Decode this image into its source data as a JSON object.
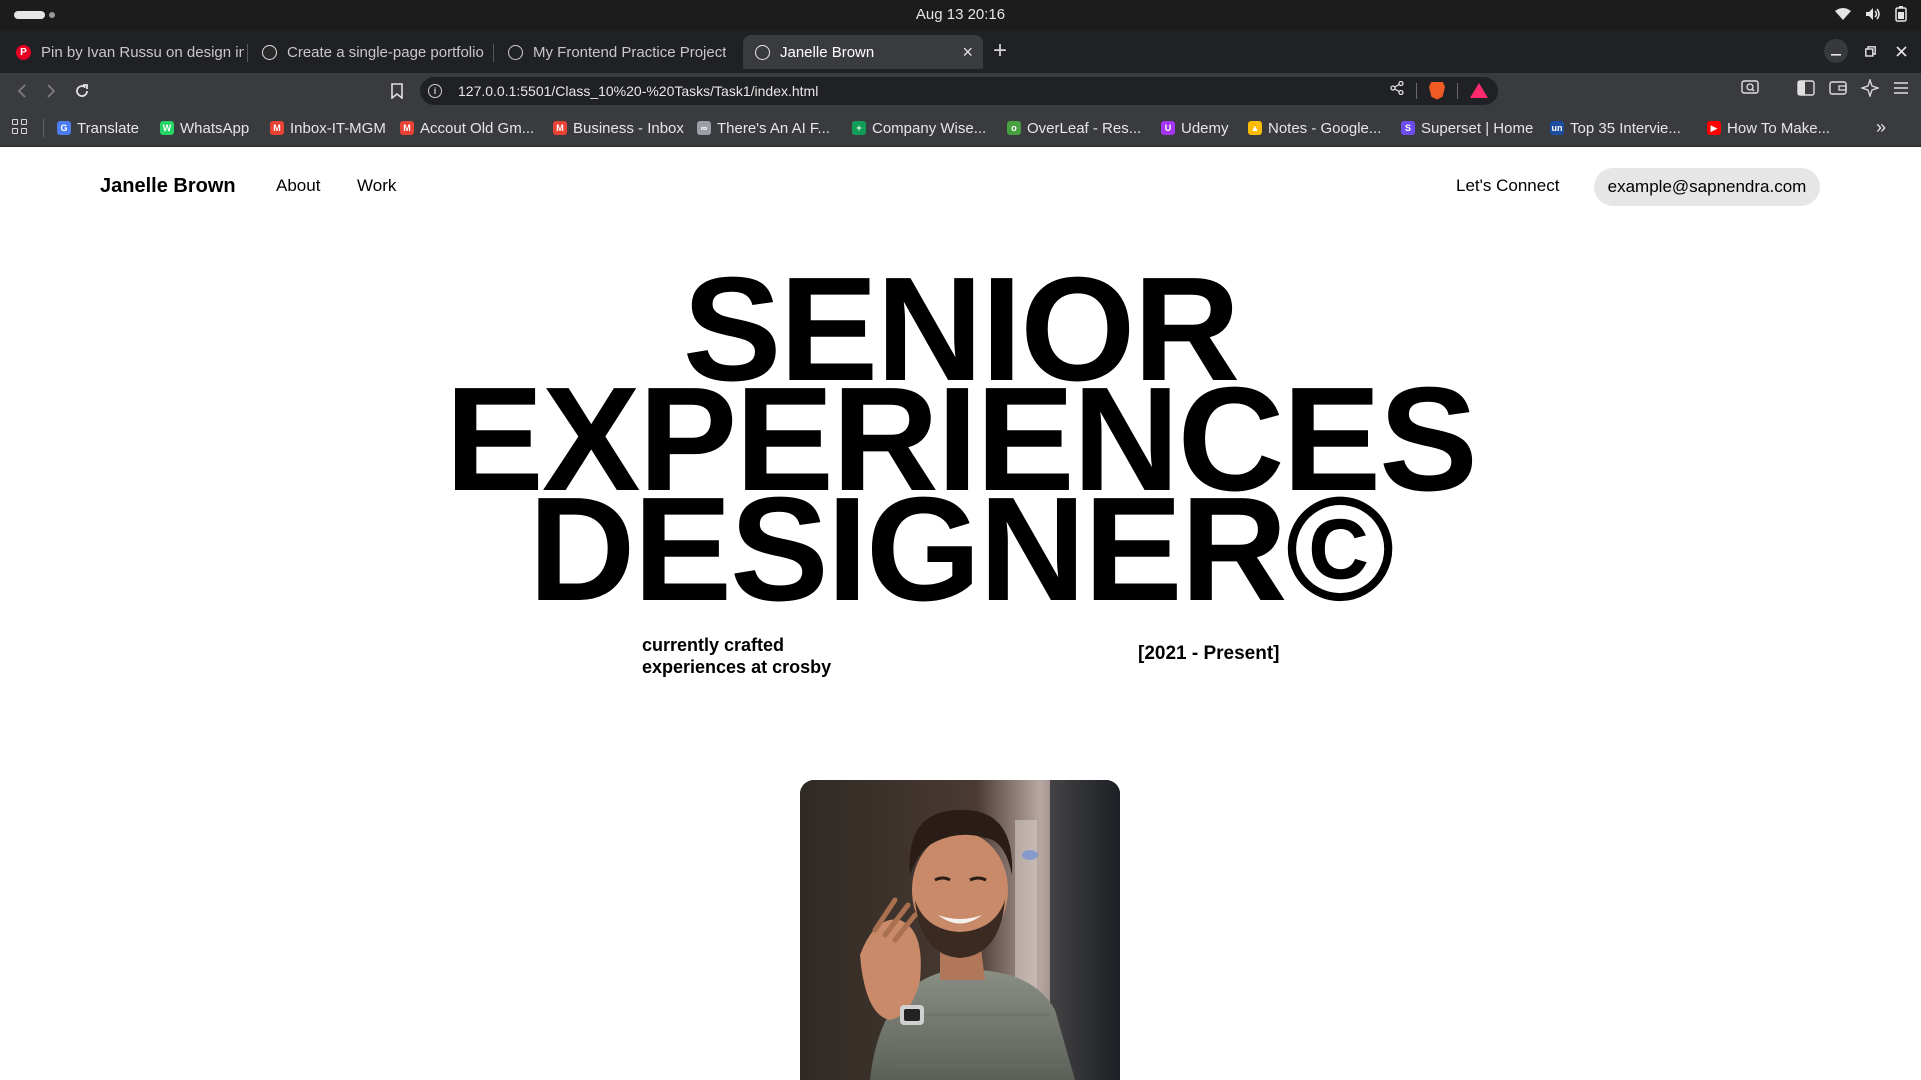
{
  "os": {
    "clock": "Aug 13  20:16",
    "status_icons": [
      "wifi-icon",
      "volume-icon",
      "battery-icon"
    ]
  },
  "browser": {
    "tabs": [
      {
        "title": "Pin by Ivan Russu on design in",
        "favicon": "pinterest-icon",
        "active": false
      },
      {
        "title": "Create a single-page portfolio",
        "favicon": "openai-icon",
        "active": false
      },
      {
        "title": "My Frontend Practice Project",
        "favicon": "globe-icon",
        "active": false
      },
      {
        "title": "Janelle Brown",
        "favicon": "globe-icon",
        "active": true
      }
    ],
    "url": "127.0.0.1:5501/Class_10%20-%20Tasks/Task1/index.html",
    "bookmarks": [
      {
        "label": "Translate",
        "icon": "translate-icon",
        "color": "#4a7df0"
      },
      {
        "label": "WhatsApp",
        "icon": "whatsapp-icon",
        "color": "#25d366"
      },
      {
        "label": "Inbox-IT-MGM",
        "icon": "gmail-icon",
        "color": "#ea4335"
      },
      {
        "label": "Accout Old Gm...",
        "icon": "gmail-icon",
        "color": "#ea4335"
      },
      {
        "label": "Business - Inbox",
        "icon": "gmail-icon",
        "color": "#ea4335"
      },
      {
        "label": "There's An AI F...",
        "icon": "link-icon",
        "color": "#9aa0a6"
      },
      {
        "label": "Company Wise...",
        "icon": "sheets-icon",
        "color": "#0f9d58"
      },
      {
        "label": "OverLeaf - Res...",
        "icon": "overleaf-icon",
        "color": "#47a141"
      },
      {
        "label": "Udemy",
        "icon": "udemy-icon",
        "color": "#a435f0"
      },
      {
        "label": "Notes - Google...",
        "icon": "drive-icon",
        "color": "#fbbc04"
      },
      {
        "label": "Superset | Home",
        "icon": "superset-icon",
        "color": "#6c4ef0"
      },
      {
        "label": "Top 35 Intervie...",
        "icon": "unstop-icon",
        "color": "#1c4da1"
      },
      {
        "label": "How To Make...",
        "icon": "youtube-icon",
        "color": "#ff0000"
      }
    ],
    "colors": {
      "tab_bar": "#202124",
      "toolbar": "#3a3b3e",
      "active_tab": "#3a3b3e"
    }
  },
  "site": {
    "brand": "Janelle Brown",
    "nav": {
      "about": "About",
      "work": "Work"
    },
    "connect": "Let's Connect",
    "email": "example@sapnendra.com",
    "hero": [
      "SENIOR",
      "EXPERIENCES",
      "DESIGNER©"
    ],
    "subtitle_line1": "currently crafted",
    "subtitle_line2": "experiences at crosby",
    "period": "[2021 - Present]",
    "email_pill_color": "#e6e6e6"
  }
}
